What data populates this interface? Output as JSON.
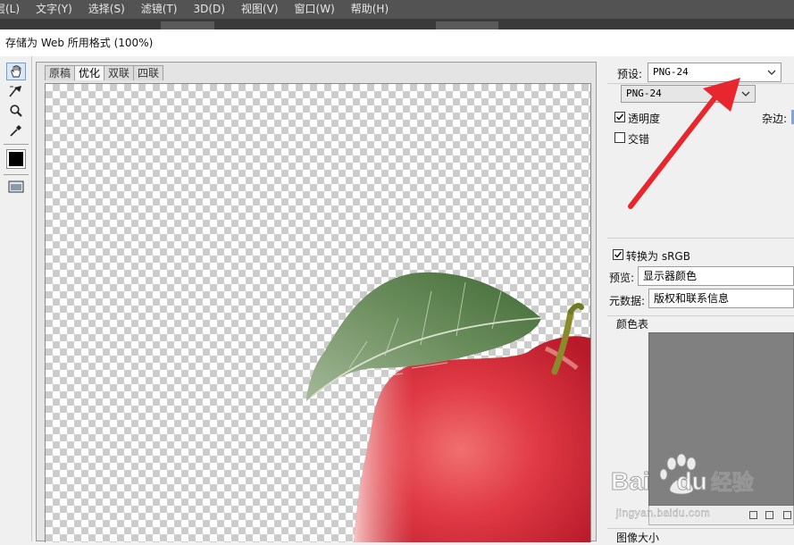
{
  "menu": [
    "层(L)",
    "文字(Y)",
    "选择(S)",
    "滤镜(T)",
    "3D(D)",
    "视图(V)",
    "窗口(W)",
    "帮助(H)"
  ],
  "dialog_title": "存储为 Web 所用格式 (100%)",
  "view_tabs": [
    "原稿",
    "优化",
    "双联",
    "四联"
  ],
  "active_view_tab": "优化",
  "tools": [
    "hand-icon",
    "slice-select-icon",
    "zoom-icon",
    "eyedropper-icon",
    "eyedropper-color-swatch",
    "toggle-slices-icon"
  ],
  "settings": {
    "preset_label": "预设:",
    "preset_value": "PNG-24",
    "format_value": "PNG-24",
    "transparency_label": "透明度",
    "transparency_checked": true,
    "matte_label": "杂边:",
    "interlaced_label": "交错",
    "interlaced_checked": false,
    "convert_srgb_label": "转换为 sRGB",
    "convert_srgb_checked": true,
    "preview_label": "预览:",
    "preview_value": "显示器颜色",
    "metadata_label": "元数据:",
    "metadata_value": "版权和联系信息",
    "color_table_label": "颜色表",
    "image_size_label": "图像大小"
  },
  "watermark": {
    "brand": "Bai",
    "brand2": "du",
    "text": "经验",
    "url": "jingyan.baidu.com"
  },
  "colors": {
    "menubar": "#535353",
    "arrow": "#e8262d",
    "color_table": "#808080"
  }
}
